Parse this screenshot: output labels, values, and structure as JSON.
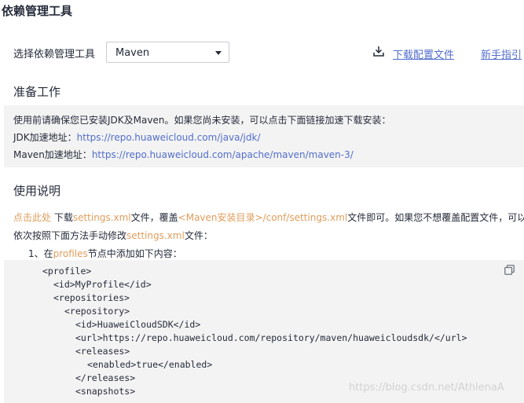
{
  "page": {
    "title": "依赖管理工具"
  },
  "tool_select": {
    "label": "选择依赖管理工具",
    "value": "Maven",
    "options": [
      "Maven"
    ]
  },
  "links": {
    "download_label": "下载配置文件",
    "guide_label": "新手指引"
  },
  "prep": {
    "title": "准备工作",
    "line1": "使用前请确保您已安装JDK及Maven。如果您尚未安装，可以点击下面链接加速下载安装：",
    "jdk_label": "JDK加速地址：",
    "jdk_url": "https://repo.huaweicloud.com/java/jdk/",
    "maven_label": "Maven加速地址：",
    "maven_url": "https://repo.huaweicloud.com/apache/maven/maven-3/"
  },
  "usage": {
    "title": "使用说明",
    "click_here": "点击此处",
    "seg_download": " 下载",
    "settings_file": "settings.xml",
    "seg_file_cover": "文件，覆盖",
    "install_dir": "<Maven安装目录>/conf/settings.xml",
    "seg_tail": "文件即可。如果您不想覆盖配置文件，可以",
    "line2_start": "依次按照下面方法手动修改",
    "line2_file": "settings.xml",
    "line2_end": "文件：",
    "step1_prefix": "1、在",
    "step1_node": "profiles",
    "step1_suffix": "节点中添加如下内容："
  },
  "code": {
    "lines": [
      "<profile>",
      "<id>MyProfile</id>",
      "<repositories>",
      "<repository>",
      "<id>HuaweiCloudSDK</id>",
      "<url>https://repo.huaweicloud.com/repository/maven/huaweicloudsdk/</url>",
      "<releases>",
      "<enabled>true</enabled>",
      "</releases>",
      "<snapshots>"
    ]
  },
  "watermark": "https://blog.csdn.net/AthlenaA",
  "colors": {
    "link": "#526ecc",
    "highlight": "#e09d5c",
    "panel_bg": "#f3f3f3",
    "text": "#252b3a"
  },
  "icons": {
    "download": "download-icon",
    "select_caret": "caret-down-icon",
    "copy": "copy-icon"
  }
}
